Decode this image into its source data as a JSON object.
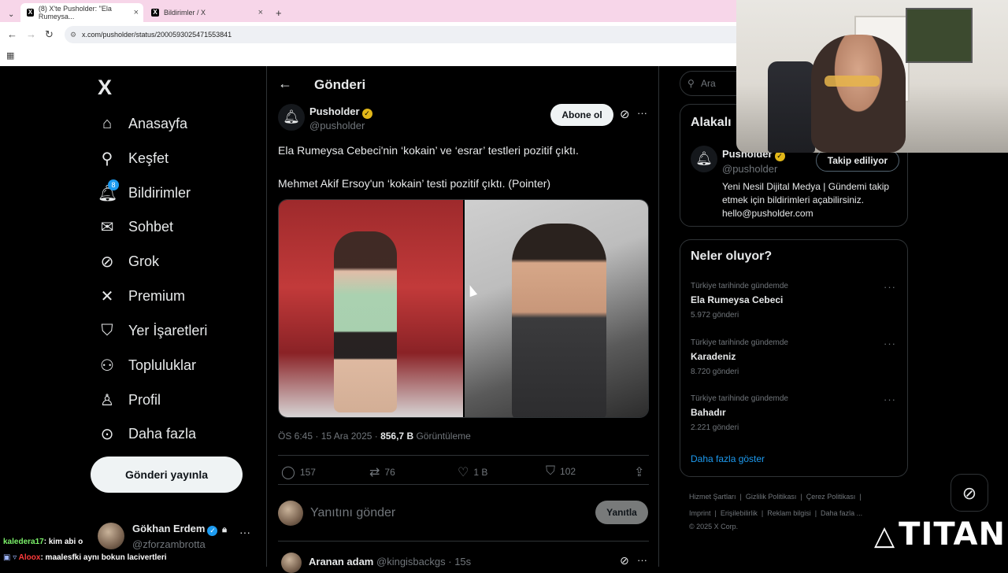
{
  "browser": {
    "tabs": [
      {
        "title": "(8) X'te Pusholder: \"Ela Rumeysa...",
        "icon": "x-icon"
      },
      {
        "title": "Bildirimler / X",
        "icon": "x-icon"
      }
    ],
    "url": "x.com/pusholder/status/2000593025471553841"
  },
  "nav": {
    "items": [
      {
        "label": "Anasayfa",
        "icon": "home-icon"
      },
      {
        "label": "Keşfet",
        "icon": "search-icon"
      },
      {
        "label": "Bildirimler",
        "icon": "bell-icon",
        "badge": "8"
      },
      {
        "label": "Sohbet",
        "icon": "mail-icon"
      },
      {
        "label": "Grok",
        "icon": "grok-icon"
      },
      {
        "label": "Premium",
        "icon": "x-icon"
      },
      {
        "label": "Yer İşaretleri",
        "icon": "bookmark-icon"
      },
      {
        "label": "Topluluklar",
        "icon": "communities-icon"
      },
      {
        "label": "Profil",
        "icon": "profile-icon"
      },
      {
        "label": "Daha fazla",
        "icon": "more-circle-icon"
      }
    ],
    "post_button": "Gönderi yayınla",
    "account": {
      "name": "Gökhan Erdem",
      "handle": "@zforzambrotta"
    }
  },
  "post": {
    "header": "Gönderi",
    "author": {
      "name": "Pusholder",
      "handle": "@pusholder"
    },
    "subscribe": "Abone ol",
    "text1": "Ela Rumeysa Cebeci'nin ‘kokain’ ve ‘esrar’ testleri pozitif çıktı.",
    "text2": "Mehmet Akif Ersoy'un ‘kokain’ testi pozitif çıktı. (Pointer)",
    "time": "ÖS 6:45 · 15 Ara 2025 · ",
    "views": "856,7 B",
    "views_label": " Görüntüleme",
    "actions": {
      "replies": "157",
      "reposts": "76",
      "likes": "1 B",
      "bookmarks": "102"
    },
    "reply_placeholder": "Yanıtını gönder",
    "reply_button": "Yanıtla",
    "next_reply": {
      "name": "Aranan adam",
      "handle": "@kingisbackgs",
      "time": "· 15s"
    }
  },
  "sidebar": {
    "search_placeholder": "Ara",
    "related_title": "Alakalı",
    "related": {
      "name": "Pusholder",
      "handle": "@pusholder",
      "follow": "Takip ediliyor",
      "bio": "Yeni Nesil Dijital Medya | Gündemi takip etmek için bildirimleri açabilirsiniz. hello@pusholder.com"
    },
    "trends_title": "Neler oluyor?",
    "trends": [
      {
        "context": "Türkiye tarihinde gündemde",
        "name": "Ela Rumeysa Cebeci",
        "count": "5.972 gönderi"
      },
      {
        "context": "Türkiye tarihinde gündemde",
        "name": "Karadeniz",
        "count": "8.720 gönderi"
      },
      {
        "context": "Türkiye tarihinde gündemde",
        "name": "Bahadır",
        "count": "2.221 gönderi"
      }
    ],
    "show_more": "Daha fazla göster",
    "footer": {
      "line1": "Hizmet Şartları  |  Gizlilik Politikası  |  Çerez Politikası  |",
      "line2": "Imprint  |  Erişilebilirlik  |  Reklam bilgisi  |  Daha fazla ...",
      "line3": "© 2025 X Corp."
    }
  },
  "chat": [
    {
      "user": "kaledera17",
      "message": ": kim abi o"
    },
    {
      "user": "Aloox",
      "message": ": maalesfki aynı bokun lacivertleri"
    }
  ],
  "overlay": {
    "brand": "TITAN"
  },
  "colors": {
    "accent": "#1d9bf0",
    "verified_gold": "#e2b719",
    "bg": "#000000",
    "text": "#e7e9ea",
    "muted": "#71767b"
  }
}
